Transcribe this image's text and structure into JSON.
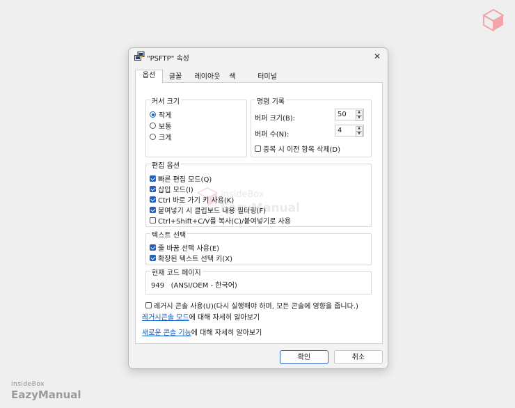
{
  "watermark": {
    "brand_small": "insideBox",
    "brand_big": "EazyManual",
    "center_text_1": "insideBox",
    "center_text_2": "EazyManual"
  },
  "dialog": {
    "title": "\"PSFTP\" 속성",
    "tabs": [
      "옵션",
      "글꼴",
      "레이아웃",
      "색",
      "터미널"
    ],
    "cursor_size": {
      "label": "커서 크기",
      "options": [
        {
          "label": "작게",
          "selected": true
        },
        {
          "label": "보통",
          "selected": false
        },
        {
          "label": "크게",
          "selected": false
        }
      ]
    },
    "command_history": {
      "label": "명령 기록",
      "buffer_size_label": "버퍼 크기(B):",
      "buffer_size_value": "50",
      "buffer_count_label": "버퍼 수(N):",
      "buffer_count_value": "4",
      "discard_duplicates_label": "중복 시 이전 항목 삭제(D)",
      "discard_duplicates_checked": false
    },
    "edit_options": {
      "label": "편집 옵션",
      "items": [
        {
          "label": "빠른 편집 모드(Q)",
          "checked": true
        },
        {
          "label": "삽입 모드(I)",
          "checked": true
        },
        {
          "label": "Ctrl 바로 가기 키 사용(K)",
          "checked": true
        },
        {
          "label": "붙여넣기 시 클립보드 내용 필터링(F)",
          "checked": true
        },
        {
          "label": "Ctrl+Shift+C/V를 복사(C)/붙여넣기로 사용",
          "checked": false
        }
      ]
    },
    "text_selection": {
      "label": "텍스트 선택",
      "items": [
        {
          "label": "줄 바꿈 선택 사용(E)",
          "checked": true
        },
        {
          "label": "확장된 텍스트 선택 키(X)",
          "checked": true
        }
      ]
    },
    "code_page": {
      "label": "현재 코드 페이지",
      "value": "949   (ANSI/OEM - 한국어)"
    },
    "legacy_console": {
      "label": "레거시 콘솔 사용(U)(다시 실행해야 하며, 모든 콘솔에 영향을 줍니다.)",
      "checked": false
    },
    "legacy_link": {
      "link_text": "레거시콘솔 모드",
      "suffix": "에 대해 자세히 알아보기"
    },
    "new_features_link": {
      "link_text": "새로운 콘솔 기능",
      "suffix": "에 대해 자세히 알아보기"
    },
    "ok_label": "확인",
    "cancel_label": "취소"
  }
}
